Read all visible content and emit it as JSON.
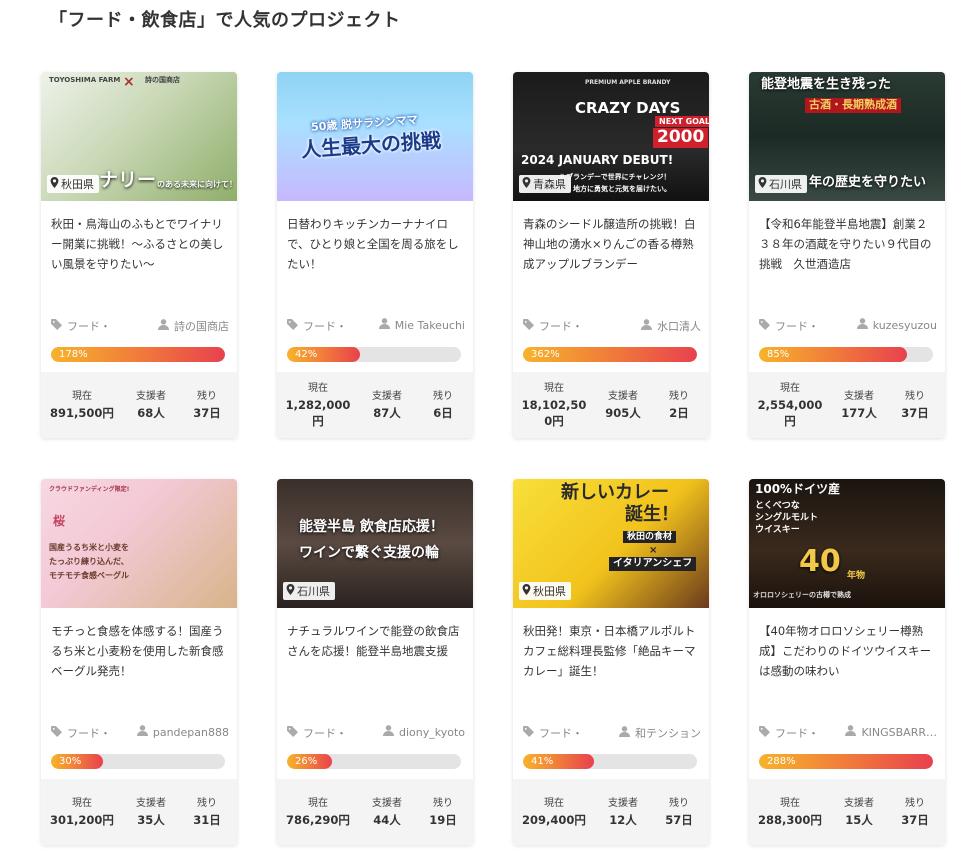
{
  "section_title": "「フード・飲食店」で人気のプロジェクト",
  "labels": {
    "current": "現在",
    "supporters": "支援者",
    "remaining": "残り"
  },
  "accent_gradient": [
    "#f7b32b",
    "#f0763c",
    "#e8414e"
  ],
  "projects": [
    {
      "image_text": [
        "TOYOSHIMA FARM",
        "×",
        "詩の国商店",
        "ナリー",
        "のある未来に向けて！"
      ],
      "location": "秋田県",
      "title": "秋田・鳥海山のふもとでワイナリー開業に挑戦！〜ふるさとの美しい風景を守りたい〜",
      "category": "フード・",
      "owner": "詩の国商店",
      "progress": 178,
      "progress_label": "178%",
      "amount": "891,500円",
      "supporters": "68人",
      "remaining": "37日"
    },
    {
      "image_text": [
        "50歳 脱サラシンママ",
        "人生最大の挑戦"
      ],
      "location": "",
      "title": "日替わりキッチンカーナナイロで、ひとり娘と全国を周る旅をしたい！",
      "category": "フード・",
      "owner": "Mie Takeuchi",
      "progress": 42,
      "progress_label": "42%",
      "amount": "1,282,000円",
      "supporters": "87人",
      "remaining": "6日"
    },
    {
      "image_text": [
        "PREMIUM APPLE BRANDY",
        "CRAZY DAYS",
        "NEXT GOAL",
        "2000",
        "2024 JANUARY DEBUT!",
        "ルブランデーで世界にチャレンジ！",
        "地方に勇気と元気を届けたい。"
      ],
      "location": "青森県",
      "title": "青森のシードル醸造所の挑戦！白神山地の湧水×りんごの香る樽熟成アップルブランデー",
      "category": "フード・",
      "owner": "水口清人",
      "progress": 362,
      "progress_label": "362%",
      "amount": "18,102,500円",
      "supporters": "905人",
      "remaining": "2日"
    },
    {
      "image_text": [
        "能登地震を生き残った",
        "古酒・長期熟成酒",
        "年の歴史を守りたい"
      ],
      "location": "石川県",
      "title": "【令和6年能登半島地震】創業２３８年の酒蔵を守りたい９代目の挑戦　久世酒造店",
      "category": "フード・",
      "owner": "kuzesyuzou",
      "progress": 85,
      "progress_label": "85%",
      "amount": "2,554,000円",
      "supporters": "177人",
      "remaining": "37日"
    },
    {
      "image_text": [
        "クラウドファンディング限定!",
        "桜",
        "国産うるち米と小麦を",
        "たっぷり練り込んだ、",
        "モチモチ食感ベーグル"
      ],
      "location": "",
      "title": "モチっと食感を体感する！国産うるち米と小麦粉を使用した新食感ベーグル発売！",
      "category": "フード・",
      "owner": "pandepan888",
      "progress": 30,
      "progress_label": "30%",
      "amount": "301,200円",
      "supporters": "35人",
      "remaining": "31日"
    },
    {
      "image_text": [
        "能登半島 飲食店応援！",
        "ワインで繋ぐ支援の輪"
      ],
      "location": "石川県",
      "title": "ナチュラルワインで能登の飲食店さんを応援！能登半島地震支援",
      "category": "フード・",
      "owner": "diony_kyoto",
      "progress": 26,
      "progress_label": "26%",
      "amount": "786,290円",
      "supporters": "44人",
      "remaining": "19日"
    },
    {
      "image_text": [
        "新しいカレー",
        "誕生！",
        "秋田の食材",
        "×",
        "イタリアンシェフ"
      ],
      "location": "秋田県",
      "title": "秋田発！東京・日本橋アルポルトカフェ総料理長監修「絶品キーマカレー」誕生！",
      "category": "フード・",
      "owner": "和テンション",
      "progress": 41,
      "progress_label": "41%",
      "amount": "209,400円",
      "supporters": "12人",
      "remaining": "57日"
    },
    {
      "image_text": [
        "100%ドイツ産",
        "とくべつな",
        "シングルモルト",
        "ウイスキー",
        "40",
        "年物",
        "オロロソシェリーの古樽で熟成"
      ],
      "location": "",
      "title": "【40年物オロロソシェリー樽熟成】こだわりのドイツウイスキーは感動の味わい",
      "category": "フード・",
      "owner": "KINGSBARR…",
      "progress": 288,
      "progress_label": "288%",
      "amount": "288,300円",
      "supporters": "15人",
      "remaining": "37日"
    }
  ]
}
